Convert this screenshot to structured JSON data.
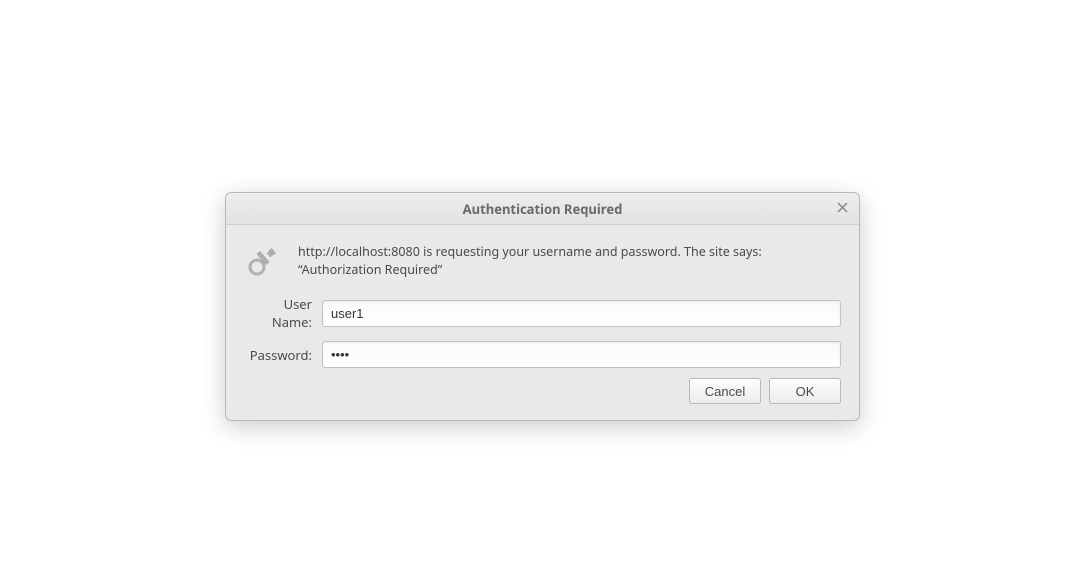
{
  "dialog": {
    "title": "Authentication Required",
    "message": "http://localhost:8080 is requesting your username and password. The site says: “Authorization Required”",
    "fields": {
      "username_label": "User Name:",
      "username_value": "user1",
      "password_label": "Password:",
      "password_value": "••••"
    },
    "buttons": {
      "cancel": "Cancel",
      "ok": "OK"
    }
  }
}
